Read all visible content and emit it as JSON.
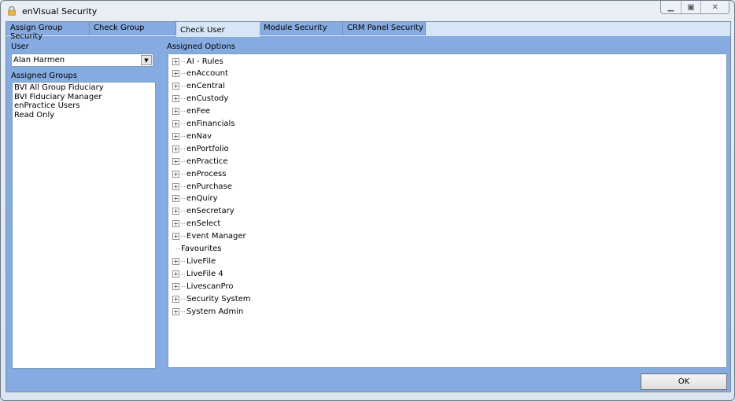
{
  "window": {
    "title": "enVisual Security",
    "icon": "lock-icon",
    "controls": [
      "minimize",
      "restore",
      "close"
    ]
  },
  "tabs": [
    {
      "label": "Assign Group Security"
    },
    {
      "label": "Check Group"
    },
    {
      "label": "Check User",
      "active": true
    },
    {
      "label": "Module Security"
    },
    {
      "label": "CRM Panel Security"
    }
  ],
  "left": {
    "user_label": "User",
    "user_value": "Alan Harmen",
    "groups_label": "Assigned Groups",
    "groups": [
      "BVI All Group Fiduciary",
      "BVI Fiduciary Manager",
      "enPractice Users",
      "Read Only"
    ]
  },
  "right": {
    "label": "Assigned Options",
    "items": [
      {
        "label": "AI - Rules",
        "expandable": true
      },
      {
        "label": "enAccount",
        "expandable": true
      },
      {
        "label": "enCentral",
        "expandable": true
      },
      {
        "label": "enCustody",
        "expandable": true
      },
      {
        "label": "enFee",
        "expandable": true
      },
      {
        "label": "enFinancials",
        "expandable": true
      },
      {
        "label": "enNav",
        "expandable": true
      },
      {
        "label": "enPortfolio",
        "expandable": true
      },
      {
        "label": "enPractice",
        "expandable": true
      },
      {
        "label": "enProcess",
        "expandable": true
      },
      {
        "label": "enPurchase",
        "expandable": true
      },
      {
        "label": "enQuiry",
        "expandable": true
      },
      {
        "label": "enSecretary",
        "expandable": true
      },
      {
        "label": "enSelect",
        "expandable": true
      },
      {
        "label": "Event Manager",
        "expandable": true
      },
      {
        "label": "Favourites",
        "expandable": false
      },
      {
        "label": "LiveFile",
        "expandable": true
      },
      {
        "label": "LiveFile 4",
        "expandable": true
      },
      {
        "label": "LivescanPro",
        "expandable": true
      },
      {
        "label": "Security System",
        "expandable": true
      },
      {
        "label": "System Admin",
        "expandable": true
      }
    ]
  },
  "footer": {
    "ok_label": "OK"
  },
  "colors": {
    "panel": "#86abe0",
    "tabstrip": "#d7e6f7"
  }
}
